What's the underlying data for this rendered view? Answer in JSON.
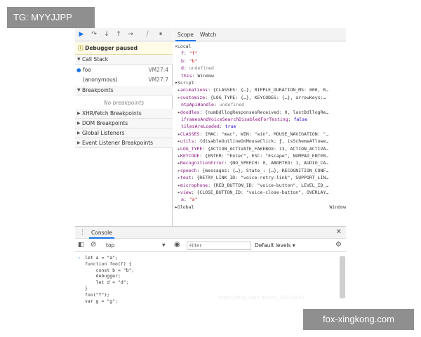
{
  "watermark_top": "TG: MYYJJPP",
  "watermark_bottom": "fox-xingkong.com",
  "watermark_faint": "https://blog.csdn.net/qq_36521649",
  "debugger": {
    "paused": "Debugger paused",
    "call_stack": {
      "title": "Call Stack",
      "frames": [
        {
          "name": "foo",
          "loc": "VM27:4"
        },
        {
          "name": "(anonymous)",
          "loc": "VM27:7"
        }
      ]
    },
    "breakpoints": {
      "title": "Breakpoints",
      "empty": "No breakpoints"
    },
    "sections": [
      "XHR/fetch Breakpoints",
      "DOM Breakpoints",
      "Global Listeners",
      "Event Listener Breakpoints"
    ]
  },
  "scope": {
    "tabs": [
      "Scope",
      "Watch"
    ],
    "local_title": "Local",
    "local_vars": [
      {
        "k": "f",
        "v": "\"f\"",
        "t": "s"
      },
      {
        "k": "b",
        "v": "\"b\"",
        "t": "s"
      },
      {
        "k": "d",
        "v": "undefined",
        "t": "g"
      },
      {
        "k": "this",
        "v": "Window",
        "t": "p"
      }
    ],
    "script_title": "Script",
    "script_vars": [
      {
        "k": "animations",
        "v": "{CLASSES: {…}, RIPPLE_DURATION_MS: 800, R…",
        "c": true
      },
      {
        "k": "customize",
        "v": "{LOG_TYPE: {…}, KEYCODES: {…}, arrowKeys:…",
        "c": true
      },
      {
        "k": "ntpApiHandle",
        "v": "undefined",
        "c": false
      },
      {
        "k": "doodles",
        "v": "{numDdllogResponsesReceived: 0, lastDdllogRe…",
        "c": true
      },
      {
        "k": "iframesAndVoiceSearchDisabledForTesting",
        "v": "false",
        "c": false
      },
      {
        "k": "tilesAreLoaded",
        "v": "true",
        "c": false
      },
      {
        "k": "CLASSES",
        "v": "{MAC: \"mac\", WIN: \"win\", MOUSE_NAVIGATION: \"…",
        "c": true
      },
      {
        "k": "utils",
        "v": "{disableOutlineOnMouseClick: ƒ, isSchemeAllowe…",
        "c": true
      },
      {
        "k": "LOG_TYPE",
        "v": "{ACTION_ACTIVATE_FAKEBOX: 13, ACTION_ACTIVA…",
        "c": true
      },
      {
        "k": "KEYCODE",
        "v": "{ENTER: \"Enter\", ESC: \"Escape\", NUMPAD_ENTER…",
        "c": true
      },
      {
        "k": "RecognitionError",
        "v": "{NO_SPEECH: 0, ABORTED: 1, AUDIO_CA…",
        "c": true
      },
      {
        "k": "speech",
        "v": "{messages: {…}, State_: {…}, RECOGNITION_CONF…",
        "c": true
      },
      {
        "k": "text",
        "v": "{RETRY_LINK_ID: \"voice-retry-link\", SUPPORT_LIN…",
        "c": true
      },
      {
        "k": "microphone",
        "v": "{RED_BUTTON_ID: \"voice-button\", LEVEL_ID_…",
        "c": true
      },
      {
        "k": "view",
        "v": "{CLOSE_BUTTON_ID: \"voice-close-button\", OVERLAY…",
        "c": true
      },
      {
        "k": "a",
        "v": "\"a\"",
        "c": false
      }
    ],
    "global_title": "Global",
    "global_value": "Window"
  },
  "console": {
    "tab": "Console",
    "context": "top",
    "filter_placeholder": "Filter",
    "levels": "Default levels ▾",
    "lines": [
      "let a = \"a\";",
      "function foo(f) {",
      "    const b = \"b\";",
      "    debugger;",
      "    let d = \"d\";",
      "}",
      "foo(\"f\");",
      "var g = \"g\";"
    ]
  },
  "colors": {
    "accent": "#1a73e8",
    "pause_bg": "#fffbe6",
    "key": "#881280",
    "string": "#c41a16",
    "watermark": "#8f8f8f"
  }
}
